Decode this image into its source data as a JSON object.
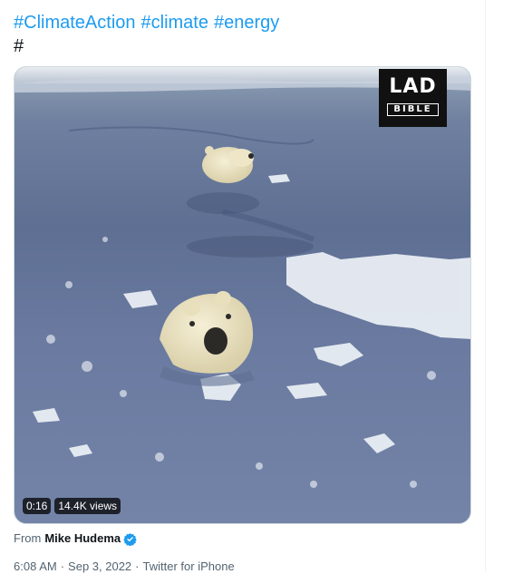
{
  "tweet": {
    "hashtags": [
      "#ClimateAction",
      "#climate",
      "#energy"
    ],
    "hash_line": "#"
  },
  "media": {
    "logo_line1": "LAD",
    "logo_line2": "BIBLE",
    "duration": "0:16",
    "views": "14.4K views"
  },
  "source": {
    "from_label": "From",
    "name": "Mike Hudema"
  },
  "meta": {
    "time": "6:08 AM",
    "date": "Sep 3, 2022",
    "client": "Twitter for iPhone"
  },
  "colors": {
    "link": "#1d9bf0",
    "verified": "#1d9bf0",
    "secondary_text": "#536471"
  },
  "icons": {
    "verified": "verified-badge-icon"
  }
}
